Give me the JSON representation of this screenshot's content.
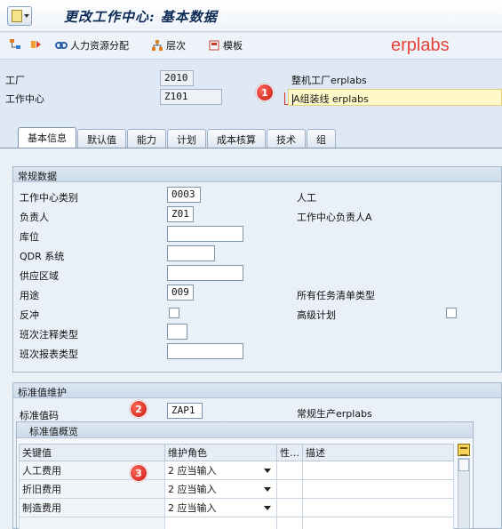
{
  "title": "更改工作中心: 基本数据",
  "brand": "erplabs",
  "toolbar": {
    "hr_label": "人力资源分配",
    "hierarchy_label": "层次",
    "template_label": "模板"
  },
  "header": {
    "plant_label": "工厂",
    "plant_value": "2010",
    "plant_desc": "整机工厂erplabs",
    "wc_label": "工作中心",
    "wc_value": "Z101",
    "wc_desc": "A组装线 erplabs"
  },
  "tabs": [
    "基本信息",
    "默认值",
    "能力",
    "计划",
    "成本核算",
    "技术",
    "组"
  ],
  "general": {
    "title": "常规数据",
    "rows": [
      {
        "label": "工作中心类别",
        "value": "0003",
        "desc": "人工"
      },
      {
        "label": "负责人",
        "value": "Z01",
        "desc": "工作中心负责人A"
      },
      {
        "label": "库位",
        "value": "",
        "desc": ""
      },
      {
        "label": "QDR 系统",
        "value": "",
        "desc": ""
      },
      {
        "label": "供应区域",
        "value": "",
        "desc": ""
      },
      {
        "label": "用途",
        "value": "009",
        "desc": "所有任务清单类型"
      },
      {
        "label": "反冲",
        "value": "",
        "desc": ""
      },
      {
        "label": "班次注释类型",
        "value": "",
        "desc": ""
      },
      {
        "label": "班次报表类型",
        "value": "",
        "desc": ""
      }
    ],
    "advanced_label": "高级计划"
  },
  "standard": {
    "title": "标准值维护",
    "key_label": "标准值码",
    "key_value": "ZAP1",
    "key_desc": "常规生产erplabs",
    "overview_title": "标准值概览",
    "columns": [
      "关键值",
      "维护角色",
      "性…",
      "描述"
    ],
    "rows": [
      {
        "key": "人工费用",
        "role": "2 应当输入"
      },
      {
        "key": "折旧费用",
        "role": "2 应当输入"
      },
      {
        "key": "制造费用",
        "role": "2 应当输入"
      }
    ]
  },
  "badges": [
    "1",
    "2",
    "3"
  ]
}
